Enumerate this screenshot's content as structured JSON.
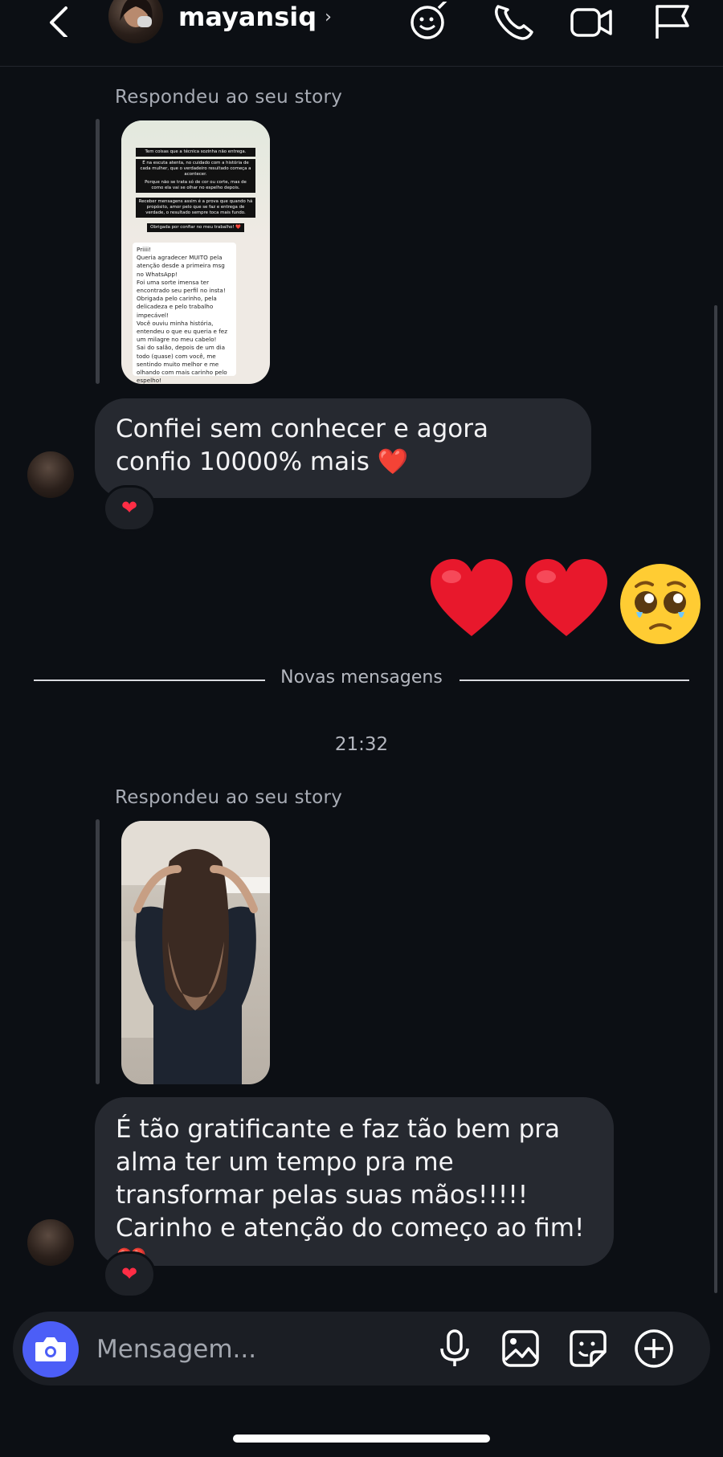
{
  "header": {
    "username": "mayansiq",
    "chevron": "›",
    "icons": [
      "back-arrow-icon",
      "avatar",
      "sticker-effects-icon",
      "phone-call-icon",
      "video-call-icon",
      "flag-icon"
    ]
  },
  "thread": {
    "story_reply_1": {
      "label": "Respondeu ao seu story",
      "story_black_lines": [
        "Tem coisas que a técnica sozinha não entrega.",
        "É na escuta atenta, no cuidado com a história de cada mulher, que o verdadeiro resultado começa a acontecer.",
        "Porque não se trata só de cor ou corte, mas de como ela vai se olhar no espelho depois.",
        "Receber mensagens assim é a prova que quando há propósito, amor pelo que se faz e entrega de verdade, o resultado sempre toca mais fundo.",
        "Obrigada por confiar no meu trabalho! ❤️"
      ],
      "story_white_text": "Priiii!\nQueria agradecer MUITO pela atenção desde a primeira msg no WhatsApp!\nFoi uma sorte imensa ter encontrado seu perfil no insta!\nObrigada pelo carinho, pela delicadeza e pelo trabalho impecável!\nVocê ouviu minha história, entendeu o que eu queria e fez um milagre no meu cabelo!\nSai do salão, depois de um dia todo (quase) com você, me sentindo muito melhor e me olhando com mais carinho pelo espelho!\nMil vezes obrigada ❤️\nEspero que cuide do meu cabelo sempre (pq deu trabalho vai muito além de fazer um cabelo lindo)"
    },
    "message_1": {
      "text": "Confiei sem conhecer e agora confio 10000% mais ❤️",
      "reaction": "❤"
    },
    "sent_emojis": [
      "red-heart",
      "red-heart",
      "pleading-face"
    ],
    "divider_label": "Novas mensagens",
    "timestamp": "21:32",
    "story_reply_2": {
      "label": "Respondeu ao seu story"
    },
    "message_2": {
      "text": "É tão gratificante e faz tão bem pra alma ter um tempo pra me transformar pelas suas mãos!!!!! Carinho e atenção do começo ao fim! ❤️",
      "reaction": "❤"
    }
  },
  "composer": {
    "placeholder": "Mensagem...",
    "icons": [
      "camera-icon",
      "microphone-icon",
      "gallery-icon",
      "sticker-icon",
      "plus-icon"
    ]
  },
  "colors": {
    "background": "#0c0f14",
    "bubble": "#262930",
    "accent": "#4c5ef7",
    "heart": "#ff2d45"
  }
}
